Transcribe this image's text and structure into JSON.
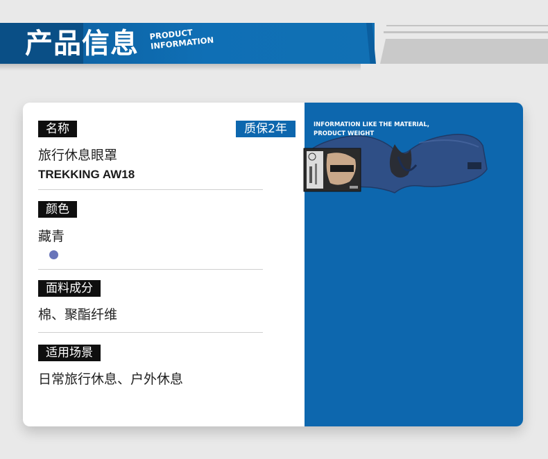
{
  "header": {
    "title_cn": "产品信息",
    "title_en_line1": "PRODUCT",
    "title_en_line2": "INFORMATION"
  },
  "colors": {
    "brand_blue": "#0d67ae",
    "label_bg": "#0f0f0f",
    "swatch_navy": "#6874b9"
  },
  "card": {
    "warranty": "质保2年",
    "name_label": "名称",
    "name_value": "旅行休息眼罩",
    "model": "TREKKING AW18",
    "color_label": "颜色",
    "color_value": "藏青",
    "material_label": "面料成分",
    "material_value": "棉、聚酯纤维",
    "usage_label": "适用场景",
    "usage_value": "日常旅行休息、户外休息"
  },
  "panel": {
    "info_line1": "INFORMATION LIKE THE MATERIAL,",
    "info_line2": "PRODUCT WEIGHT"
  },
  "product_image": {
    "icon": "eye-mask-product-image"
  }
}
